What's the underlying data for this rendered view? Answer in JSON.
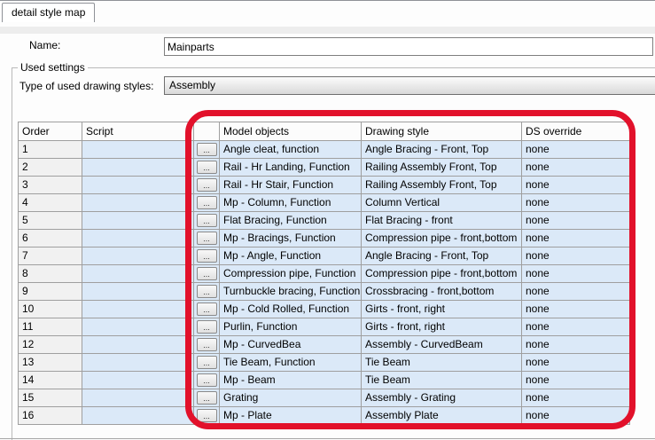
{
  "tab": {
    "label": "detail style map"
  },
  "form": {
    "name_label": "Name:",
    "name_value": "Mainparts",
    "group_label": "Used settings",
    "type_label": "Type of used drawing styles:",
    "type_value": "Assembly"
  },
  "table": {
    "columns": [
      "Order",
      "Script",
      "",
      "Model objects",
      "Drawing style",
      "DS override"
    ],
    "row_button_label": "...",
    "rows": [
      {
        "order": "1",
        "script": "",
        "model_objects": "Angle cleat, function",
        "drawing_style": "Angle Bracing - Front, Top",
        "ds_override": "none"
      },
      {
        "order": "2",
        "script": "",
        "model_objects": "Rail - Hr Landing, Function",
        "drawing_style": "Railing Assembly Front, Top",
        "ds_override": "none"
      },
      {
        "order": "3",
        "script": "",
        "model_objects": "Rail - Hr Stair, Function",
        "drawing_style": "Railing Assembly Front, Top",
        "ds_override": "none"
      },
      {
        "order": "4",
        "script": "",
        "model_objects": "Mp - Column, Function",
        "drawing_style": "Column Vertical",
        "ds_override": "none"
      },
      {
        "order": "5",
        "script": "",
        "model_objects": "Flat Bracing, Function",
        "drawing_style": "Flat Bracing - front",
        "ds_override": "none"
      },
      {
        "order": "6",
        "script": "",
        "model_objects": "Mp - Bracings, Function",
        "drawing_style": "Compression pipe - front,bottom",
        "ds_override": "none"
      },
      {
        "order": "7",
        "script": "",
        "model_objects": "Mp - Angle, Function",
        "drawing_style": "Angle Bracing - Front, Top",
        "ds_override": "none"
      },
      {
        "order": "8",
        "script": "",
        "model_objects": "Compression pipe, Function",
        "drawing_style": "Compression pipe - front,bottom",
        "ds_override": "none"
      },
      {
        "order": "9",
        "script": "",
        "model_objects": "Turnbuckle bracing, Function",
        "drawing_style": "Crossbracing - front,bottom",
        "ds_override": "none"
      },
      {
        "order": "10",
        "script": "",
        "model_objects": "Mp - Cold Rolled, Function",
        "drawing_style": "Girts - front, right",
        "ds_override": "none"
      },
      {
        "order": "11",
        "script": "",
        "model_objects": "Purlin, Function",
        "drawing_style": "Girts - front, right",
        "ds_override": "none"
      },
      {
        "order": "12",
        "script": "",
        "model_objects": "Mp - CurvedBea",
        "drawing_style": "Assembly - CurvedBeam",
        "ds_override": "none"
      },
      {
        "order": "13",
        "script": "",
        "model_objects": "Tie Beam, Function",
        "drawing_style": "Tie Beam",
        "ds_override": "none"
      },
      {
        "order": "14",
        "script": "",
        "model_objects": "Mp - Beam",
        "drawing_style": "Tie Beam",
        "ds_override": "none"
      },
      {
        "order": "15",
        "script": "",
        "model_objects": "Grating",
        "drawing_style": "Assembly - Grating",
        "ds_override": "none"
      },
      {
        "order": "16",
        "script": "",
        "model_objects": "Mp - Plate",
        "drawing_style": "Assembly Plate",
        "ds_override": "none"
      }
    ]
  },
  "colors": {
    "annotation_red": "#e2112b",
    "row_blue": "#dbe9f8",
    "order_gray": "#f1f1f1",
    "grid_line": "#9f9f9f"
  }
}
